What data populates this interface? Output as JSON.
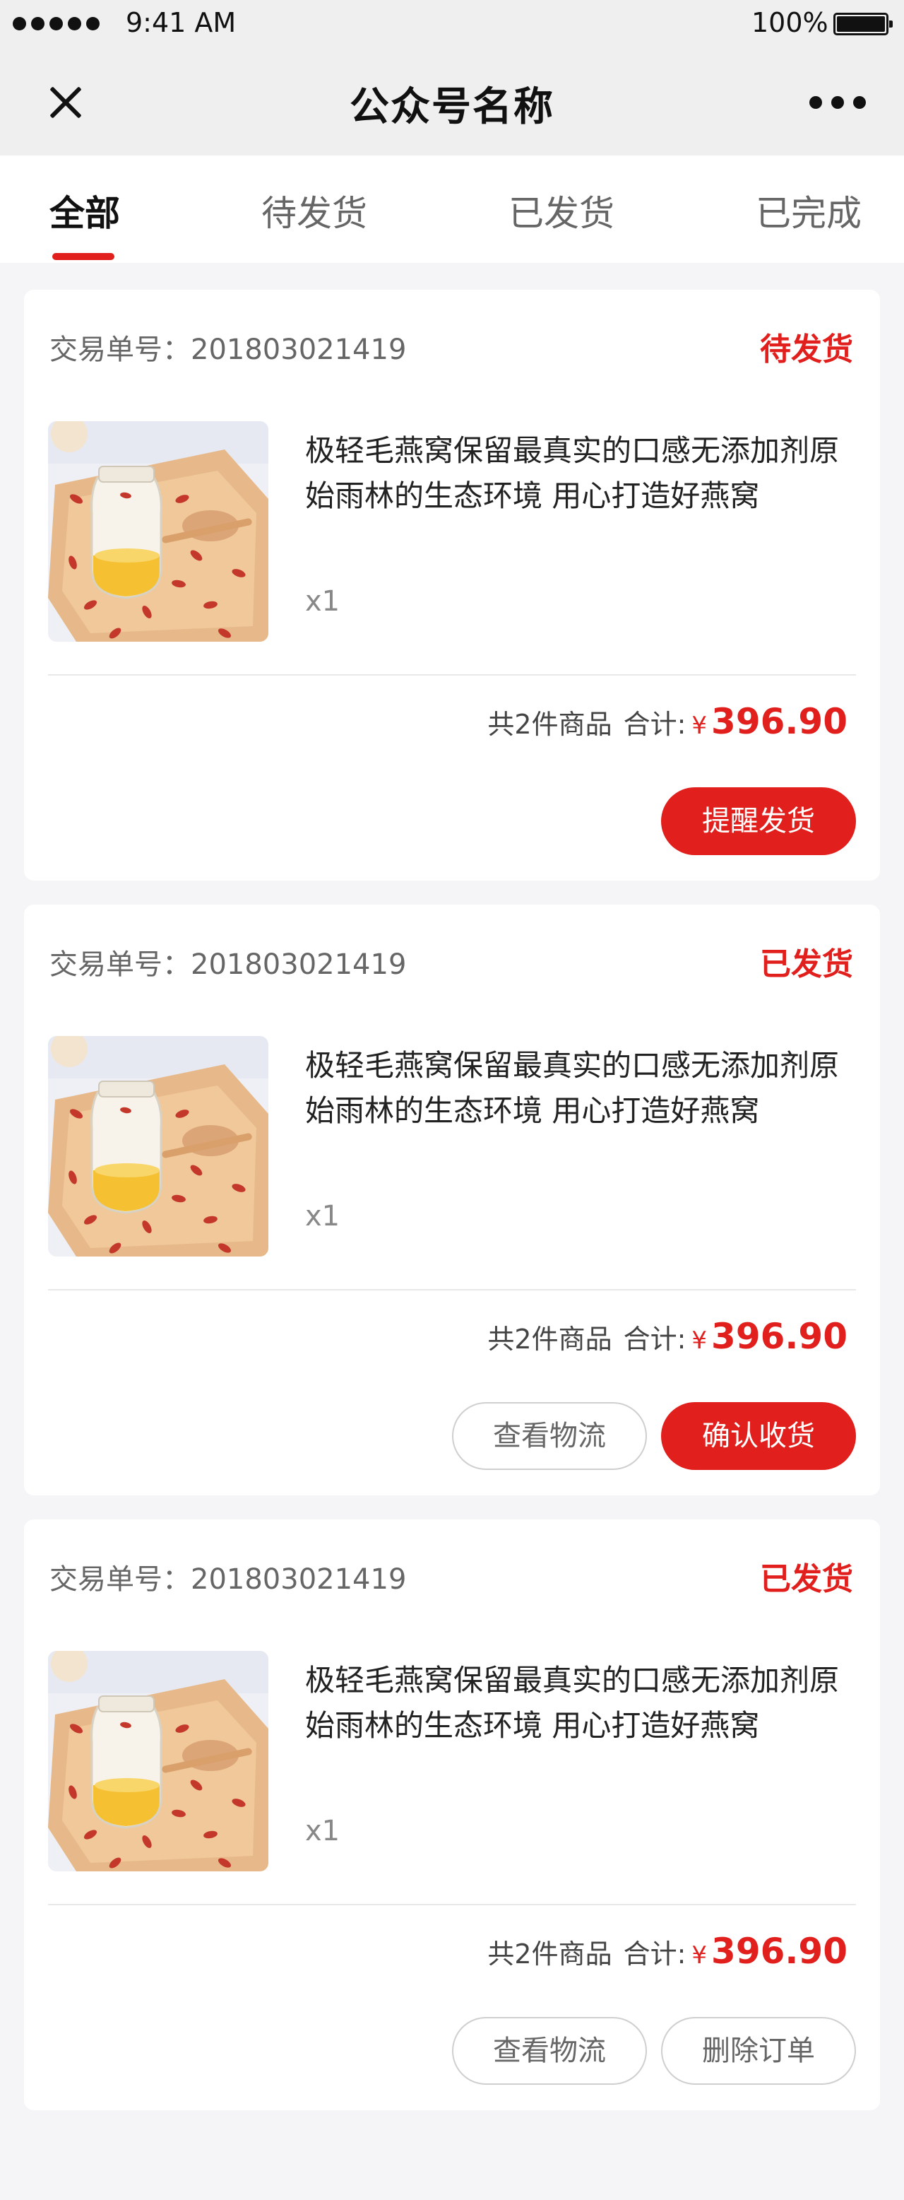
{
  "status_bar": {
    "time": "9:41 AM",
    "battery": "100%"
  },
  "nav": {
    "title": "公众号名称"
  },
  "tabs": [
    {
      "label": "全部",
      "active": true
    },
    {
      "label": "待发货",
      "active": false
    },
    {
      "label": "已发货",
      "active": false
    },
    {
      "label": "已完成",
      "active": false
    }
  ],
  "orders": [
    {
      "order_no": "交易单号：201803021419",
      "status": "待发货",
      "product_title": "极轻毛燕窝保留最真实的口感无添加剂原始雨林的生态环境 用心打造好燕窝",
      "quantity": "x1",
      "count_text": "共2件商品",
      "total_label": "合计:",
      "currency": "¥",
      "amount": "396.90",
      "buttons": [
        "提醒发货"
      ]
    },
    {
      "order_no": "交易单号：201803021419",
      "status": "已发货",
      "product_title": "极轻毛燕窝保留最真实的口感无添加剂原始雨林的生态环境 用心打造好燕窝",
      "quantity": "x1",
      "count_text": "共2件商品",
      "total_label": "合计:",
      "currency": "¥",
      "amount": "396.90",
      "buttons": [
        "查看物流",
        "确认收货"
      ]
    },
    {
      "order_no": "交易单号：201803021419",
      "status": "已发货",
      "product_title": "极轻毛燕窝保留最真实的口感无添加剂原始雨林的生态环境 用心打造好燕窝",
      "quantity": "x1",
      "count_text": "共2件商品",
      "total_label": "合计:",
      "currency": "¥",
      "amount": "396.90",
      "buttons": [
        "查看物流",
        "删除订单"
      ]
    }
  ],
  "colors": {
    "accent": "#e1201d",
    "background": "#f5f5f7"
  }
}
